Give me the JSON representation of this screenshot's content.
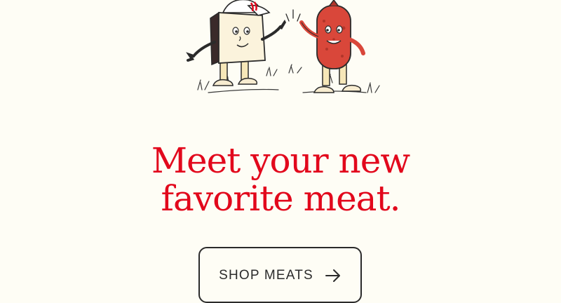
{
  "hero": {
    "headline_line1": "Meet your new",
    "headline_line2": "favorite meat.",
    "illustration": "cheese-and-salami-high-five"
  },
  "cta": {
    "label": "SHOP MEATS",
    "icon": "arrow-right-icon"
  },
  "colors": {
    "background": "#fefdf5",
    "accent_red": "#e2081c",
    "ink": "#2b2b2b"
  }
}
